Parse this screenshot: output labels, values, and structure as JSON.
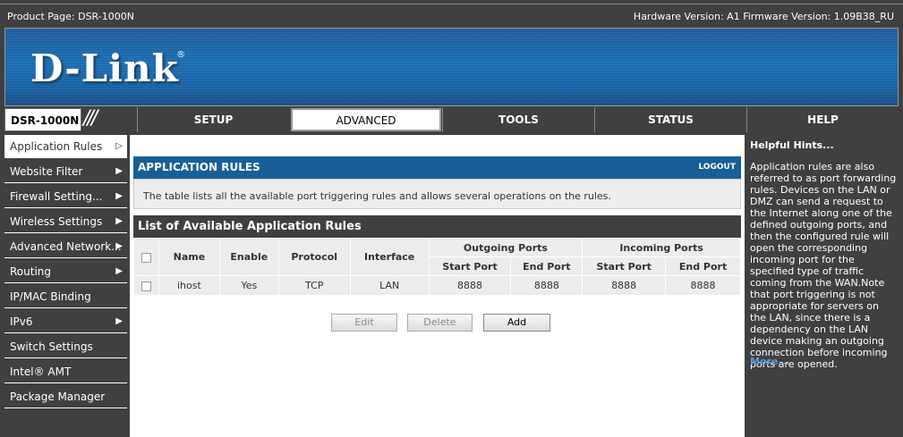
{
  "header": {
    "product": "Product Page: DSR-1000N",
    "hw_fw": "Hardware Version: A1   Firmware Version: 1.09B38_RU"
  },
  "brand": {
    "logo": "D-Link",
    "reg": "®"
  },
  "nav": {
    "model": "DSR-1000N",
    "tabs": [
      "SETUP",
      "ADVANCED",
      "TOOLS",
      "STATUS",
      "HELP"
    ]
  },
  "sidebar": {
    "items": [
      {
        "label": "Application Rules",
        "arrow": "▷"
      },
      {
        "label": "Website Filter",
        "arrow": "▶"
      },
      {
        "label": "Firewall Setting...",
        "arrow": "▶"
      },
      {
        "label": "Wireless Settings",
        "arrow": "▶"
      },
      {
        "label": "Advanced Network...",
        "arrow": "▶"
      },
      {
        "label": "Routing",
        "arrow": "▶"
      },
      {
        "label": "IP/MAC Binding",
        "arrow": ""
      },
      {
        "label": "IPv6",
        "arrow": "▶"
      },
      {
        "label": "Switch Settings",
        "arrow": ""
      },
      {
        "label": "Intel® AMT",
        "arrow": ""
      },
      {
        "label": "Package Manager",
        "arrow": ""
      }
    ]
  },
  "main": {
    "title": "APPLICATION RULES",
    "logout": "LOGOUT",
    "description": "The table lists all the available port triggering rules and allows several operations on the rules.",
    "list_title": "List of Available Application Rules",
    "headers": {
      "name": "Name",
      "enable": "Enable",
      "protocol": "Protocol",
      "interface": "Interface",
      "outgoing": "Outgoing Ports",
      "incoming": "Incoming Ports",
      "start": "Start Port",
      "end": "End Port"
    },
    "rows": [
      {
        "name": "ihost",
        "enable": "Yes",
        "protocol": "TCP",
        "interface": "LAN",
        "out_start": "8888",
        "out_end": "8888",
        "in_start": "8888",
        "in_end": "8888"
      }
    ],
    "buttons": {
      "edit": "Edit",
      "delete": "Delete",
      "add": "Add"
    }
  },
  "hints": {
    "title": "Helpful Hints...",
    "text": "Application rules are also referred to as port forwarding rules. Devices on the LAN or DMZ can send a request to the Internet along one of the defined outgoing ports, and then the configured rule will open the corresponding incoming port for the specified type of traffic coming from the WAN.Note that port triggering is not appropriate for servers on the LAN, since there is a dependency on the LAN device making an outgoing connection before incoming ports are opened.",
    "more": "More..."
  }
}
